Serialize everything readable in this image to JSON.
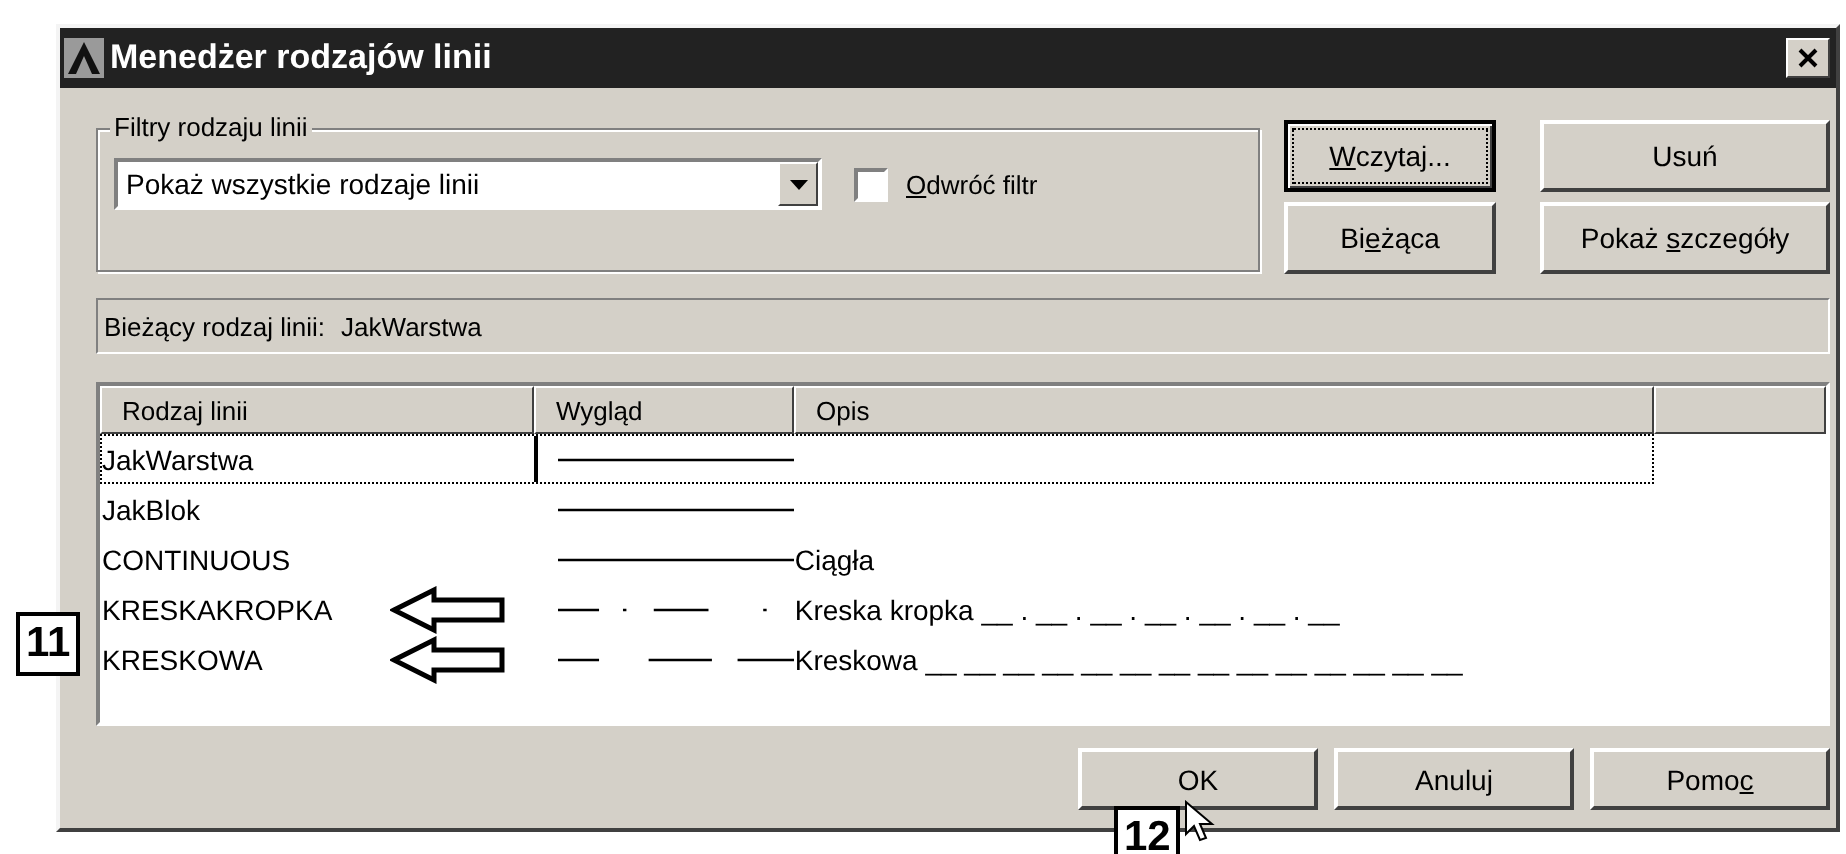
{
  "window": {
    "title": "Menedżer rodzajów linii"
  },
  "filter": {
    "legend": "Filtry rodzaju linii",
    "value": "Pokaż wszystkie rodzaje linii",
    "invert": {
      "key": "O",
      "post": "dwróć filtr",
      "checked": false
    }
  },
  "side_buttons": [
    {
      "key": "W",
      "post": "czytaj...",
      "focused": true
    },
    {
      "pre": "Usuń",
      "focused": false
    },
    {
      "pre": "Bi",
      "key": "e",
      "post": "żąca",
      "focused": false
    },
    {
      "pre": "Pokaż ",
      "key": "s",
      "post": "zczegóły",
      "focused": false
    }
  ],
  "current": {
    "label": "Bieżący rodzaj linii:",
    "value": "JakWarstwa"
  },
  "table": {
    "columns": [
      "Rodzaj linii",
      "Wygląd",
      "Opis"
    ],
    "rows": [
      {
        "name": "JakWarstwa",
        "kind": "continuous",
        "selected": true,
        "arrow": false
      },
      {
        "name": "JakBlok",
        "kind": "continuous",
        "selected": false,
        "arrow": false
      },
      {
        "name": "CONTINUOUS",
        "kind": "continuous",
        "description": "Ciągła",
        "selected": false,
        "arrow": false
      },
      {
        "name": "KRESKAKROPKA",
        "kind": "dashdot",
        "description": "Kreska kropka __ . __ . __ . __ . __ . __ . __",
        "selected": false,
        "arrow": true
      },
      {
        "name": "KRESKOWA",
        "kind": "dashed",
        "description": "Kreskowa __ __ __ __ __ __ __ __ __ __ __ __ __ __",
        "selected": false,
        "arrow": true
      }
    ]
  },
  "buttons": [
    {
      "pre": "OK"
    },
    {
      "pre": "Anuluj"
    },
    {
      "pre": "Pomo",
      "key": "c"
    }
  ],
  "callouts": [
    {
      "text": "11",
      "kind": "left"
    },
    {
      "text": "12",
      "kind": "bottom"
    }
  ]
}
